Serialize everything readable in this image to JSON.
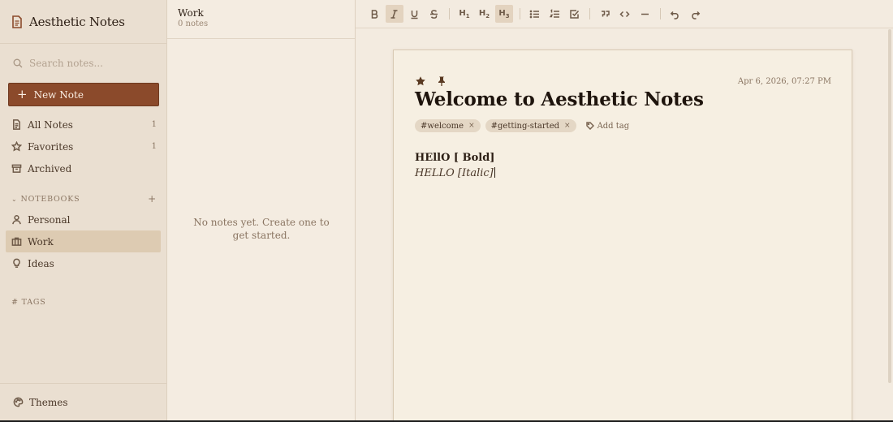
{
  "app": {
    "title": "Aesthetic Notes"
  },
  "search": {
    "placeholder": "Search notes..."
  },
  "actions": {
    "new_note": "New Note"
  },
  "nav": [
    {
      "label": "All Notes",
      "count": "1",
      "icon": "file-text-icon"
    },
    {
      "label": "Favorites",
      "count": "1",
      "icon": "star-icon"
    },
    {
      "label": "Archived",
      "count": "",
      "icon": "archive-icon"
    }
  ],
  "notebooks": {
    "heading": "NOTEBOOKS",
    "add": "+",
    "items": [
      {
        "label": "Personal",
        "icon": "user-icon"
      },
      {
        "label": "Work",
        "icon": "briefcase-icon",
        "active": true
      },
      {
        "label": "Ideas",
        "icon": "lightbulb-icon"
      }
    ]
  },
  "tags_section": {
    "heading": "# TAGS"
  },
  "footer": {
    "themes": "Themes"
  },
  "note_list": {
    "title": "Work",
    "count": "0 notes",
    "empty": "No notes yet. Create one to get started."
  },
  "toolbar": {
    "h1": "H",
    "h1_sub": "1",
    "h2": "H",
    "h2_sub": "2",
    "h3": "H",
    "h3_sub": "3"
  },
  "note": {
    "date": "Apr 6, 2026, 07:27 PM",
    "title": "Welcome to Aesthetic Notes",
    "tags": [
      "#welcome",
      "#getting-started"
    ],
    "tag_remove": "×",
    "add_tag": "Add tag",
    "line1": "HEllO [ Bold]",
    "line2": "HELLO [Italic]"
  },
  "colors": {
    "accent": "#8b4a2b",
    "sidebar": "#eadfd1",
    "paper": "#f6efe2",
    "active": "#ddcbb2"
  }
}
